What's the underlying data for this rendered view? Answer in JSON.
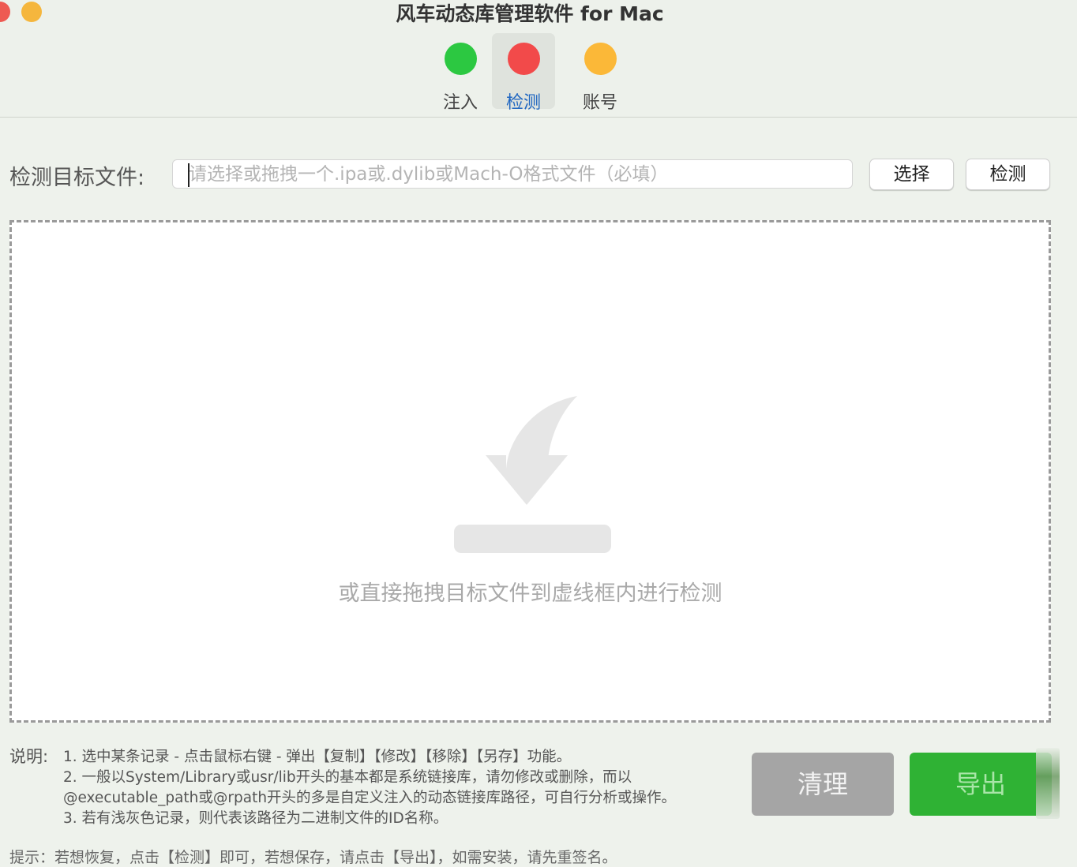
{
  "window": {
    "title": "风车动态库管理软件 for Mac"
  },
  "toolbar": {
    "items": [
      {
        "label": "注入",
        "color": "#2cc841"
      },
      {
        "label": "检测",
        "color": "#f24a4a"
      },
      {
        "label": "账号",
        "color": "#fbb838"
      }
    ]
  },
  "form": {
    "target_label": "检测目标文件:",
    "input_placeholder": "请选择或拖拽一个.ipa或.dylib或Mach-O格式文件（必填）",
    "select_label": "选择",
    "detect_label": "检测"
  },
  "dropzone": {
    "hint": "或直接拖拽目标文件到虚线框内进行检测",
    "icon": "download-arrow-icon"
  },
  "notes": {
    "label": "说明:",
    "lines": [
      "1. 选中某条记录 - 点击鼠标右键 - 弹出【复制】【修改】【移除】【另存】功能。",
      "2. 一般以System/Library或usr/lib开头的基本都是系统链接库，请勿修改或删除，而以",
      "@executable_path或@rpath开头的多是自定义注入的动态链接库路径，可自行分析或操作。",
      "3. 若有浅灰色记录，则代表该路径为二进制文件的ID名称。"
    ]
  },
  "actions": {
    "clear_label": "清理",
    "export_label": "导出"
  },
  "tips": "提示：若想恢复，点击【检测】即可，若想保存，请点击【导出】，如需安装，请先重签名。"
}
